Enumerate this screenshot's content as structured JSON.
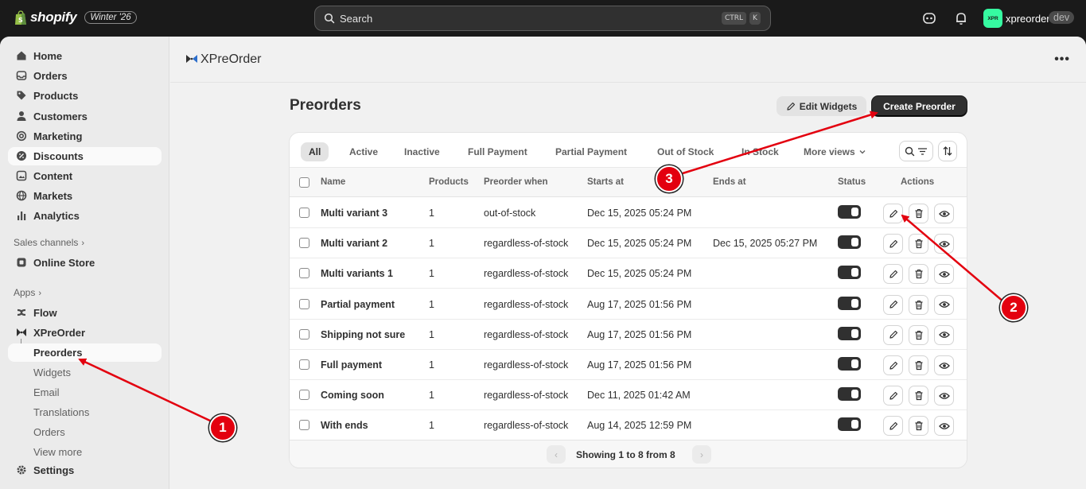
{
  "topbar": {
    "brand": "shopify",
    "badge": "Winter '26",
    "search_placeholder": "Search",
    "kbd_ctrl": "CTRL",
    "kbd_k": "K",
    "store_initials": "XPR",
    "store_name": "xpreorder",
    "store_tag": "dev"
  },
  "sidebar": {
    "items": [
      {
        "label": "Home",
        "icon": "home-icon"
      },
      {
        "label": "Orders",
        "icon": "inbox-icon"
      },
      {
        "label": "Products",
        "icon": "tag-icon"
      },
      {
        "label": "Customers",
        "icon": "person-icon"
      },
      {
        "label": "Marketing",
        "icon": "target-icon"
      },
      {
        "label": "Discounts",
        "icon": "discount-icon"
      },
      {
        "label": "Content",
        "icon": "content-icon"
      },
      {
        "label": "Markets",
        "icon": "globe-icon"
      },
      {
        "label": "Analytics",
        "icon": "bar-chart-icon"
      }
    ],
    "sales_channels_label": "Sales channels",
    "online_store": "Online Store",
    "apps_label": "Apps",
    "flow": "Flow",
    "xpreorder": "XPreOrder",
    "sub_items": [
      "Preorders",
      "Widgets",
      "Email",
      "Translations",
      "Orders",
      "View more"
    ],
    "settings": "Settings",
    "chevron": "›"
  },
  "app_header": {
    "title": "XPreOrder",
    "more": "•••"
  },
  "page": {
    "title": "Preorders",
    "edit_widgets": "Edit Widgets",
    "create_preorder": "Create Preorder"
  },
  "tabs": [
    "All",
    "Active",
    "Inactive",
    "Full Payment",
    "Partial Payment",
    "Out of Stock",
    "In Stock",
    "More views"
  ],
  "columns": {
    "name": "Name",
    "products": "Products",
    "when": "Preorder when",
    "starts": "Starts at",
    "ends": "Ends at",
    "status": "Status",
    "actions": "Actions"
  },
  "rows": [
    {
      "name": "Multi variant 3",
      "products": "1",
      "when": "out-of-stock",
      "starts": "Dec 15, 2025 05:24 PM",
      "ends": "",
      "status": "on"
    },
    {
      "name": "Multi variant 2",
      "products": "1",
      "when": "regardless-of-stock",
      "starts": "Dec 15, 2025 05:24 PM",
      "ends": "Dec 15, 2025 05:27 PM",
      "status": "on"
    },
    {
      "name": "Multi variants 1",
      "products": "1",
      "when": "regardless-of-stock",
      "starts": "Dec 15, 2025 05:24 PM",
      "ends": "",
      "status": "on"
    },
    {
      "name": "Partial payment",
      "products": "1",
      "when": "regardless-of-stock",
      "starts": "Aug 17, 2025 01:56 PM",
      "ends": "",
      "status": "on"
    },
    {
      "name": "Shipping not sure",
      "products": "1",
      "when": "regardless-of-stock",
      "starts": "Aug 17, 2025 01:56 PM",
      "ends": "",
      "status": "on"
    },
    {
      "name": "Full payment",
      "products": "1",
      "when": "regardless-of-stock",
      "starts": "Aug 17, 2025 01:56 PM",
      "ends": "",
      "status": "on"
    },
    {
      "name": "Coming soon",
      "products": "1",
      "when": "regardless-of-stock",
      "starts": "Dec 11, 2025 01:42 AM",
      "ends": "",
      "status": "on"
    },
    {
      "name": "With ends",
      "products": "1",
      "when": "regardless-of-stock",
      "starts": "Aug 14, 2025 12:59 PM",
      "ends": "",
      "status": "on"
    }
  ],
  "pagination": {
    "text": "Showing 1 to 8 from 8",
    "prev": "‹",
    "next": "›"
  },
  "annotations": [
    "1",
    "2",
    "3"
  ],
  "colors": {
    "annotation_red": "#e3000f",
    "primary_button": "#303030",
    "topbar": "#1a1a1a",
    "store_avatar": "#36fba1"
  }
}
